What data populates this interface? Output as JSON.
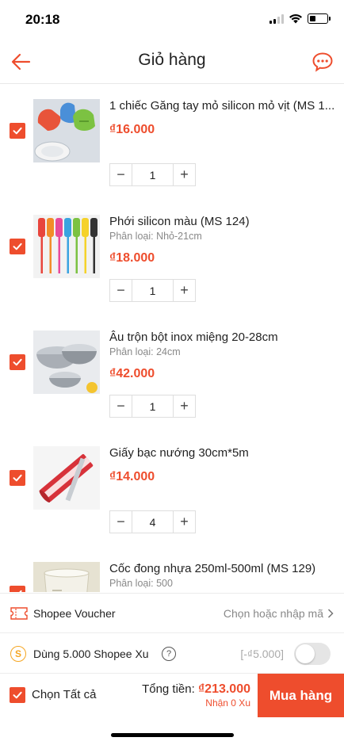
{
  "status_bar": {
    "time": "20:18"
  },
  "header": {
    "title": "Giỏ hàng"
  },
  "cart": {
    "items": [
      {
        "title": "1 chiếc Găng tay mỏ silicon mỏ vịt (MS 1...",
        "variant": "",
        "price": "₫16.000",
        "quantity": "1",
        "checked": true
      },
      {
        "title": "Phới silicon màu (MS 124)",
        "variant": "Phân loại: Nhỏ-21cm",
        "price": "₫18.000",
        "quantity": "1",
        "checked": true
      },
      {
        "title": "Âu trộn bột inox miệng 20-28cm",
        "variant": "Phân loại: 24cm",
        "price": "₫42.000",
        "quantity": "1",
        "checked": true
      },
      {
        "title": "Giấy bạc nướng 30cm*5m",
        "variant": "",
        "price": "₫14.000",
        "quantity": "4",
        "checked": true
      },
      {
        "title": "Cốc đong nhựa 250ml-500ml (MS 129)",
        "variant": "Phân loại: 500",
        "price": "",
        "quantity": "",
        "checked": true
      }
    ],
    "qty_minus": "−",
    "qty_plus": "+"
  },
  "voucher": {
    "label": "Shopee Voucher",
    "action": "Chọn hoặc nhập mã"
  },
  "coins": {
    "icon_letter": "S",
    "label": "Dùng 5.000 Shopee Xu",
    "help": "?",
    "discount": "[-₫5.000]",
    "enabled": false
  },
  "checkout": {
    "select_all_label": "Chọn Tất cả",
    "total_label": "Tổng tiền:",
    "total_amount": "₫213.000",
    "coins_earned": "Nhận 0 Xu",
    "buy_label": "Mua hàng"
  },
  "colors": {
    "accent": "#ee4d2d",
    "coin": "#f5a623"
  }
}
